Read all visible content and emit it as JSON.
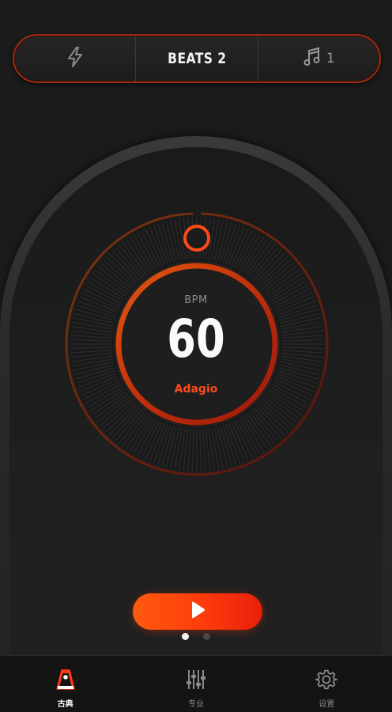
{
  "topbar": {
    "flash_icon": "lightning-bolt-icon",
    "beats_label": "BEATS 2",
    "sound_icon": "music-note-icon",
    "sound_count": "1"
  },
  "dial": {
    "bpm_label": "BPM",
    "bpm_value": "60",
    "tempo_name": "Adagio"
  },
  "controls": {
    "play_icon": "play-icon",
    "page_dots": {
      "count": 2,
      "active_index": 0
    }
  },
  "bottom_nav": {
    "items": [
      {
        "label": "古典",
        "icon": "metronome-icon",
        "active": true
      },
      {
        "label": "专业",
        "icon": "sliders-icon",
        "active": false
      },
      {
        "label": "设置",
        "icon": "gear-icon",
        "active": false
      }
    ]
  },
  "colors": {
    "accent": "#ff4a1c",
    "accent_dark": "#c8200c",
    "background": "#1b1b1b"
  }
}
